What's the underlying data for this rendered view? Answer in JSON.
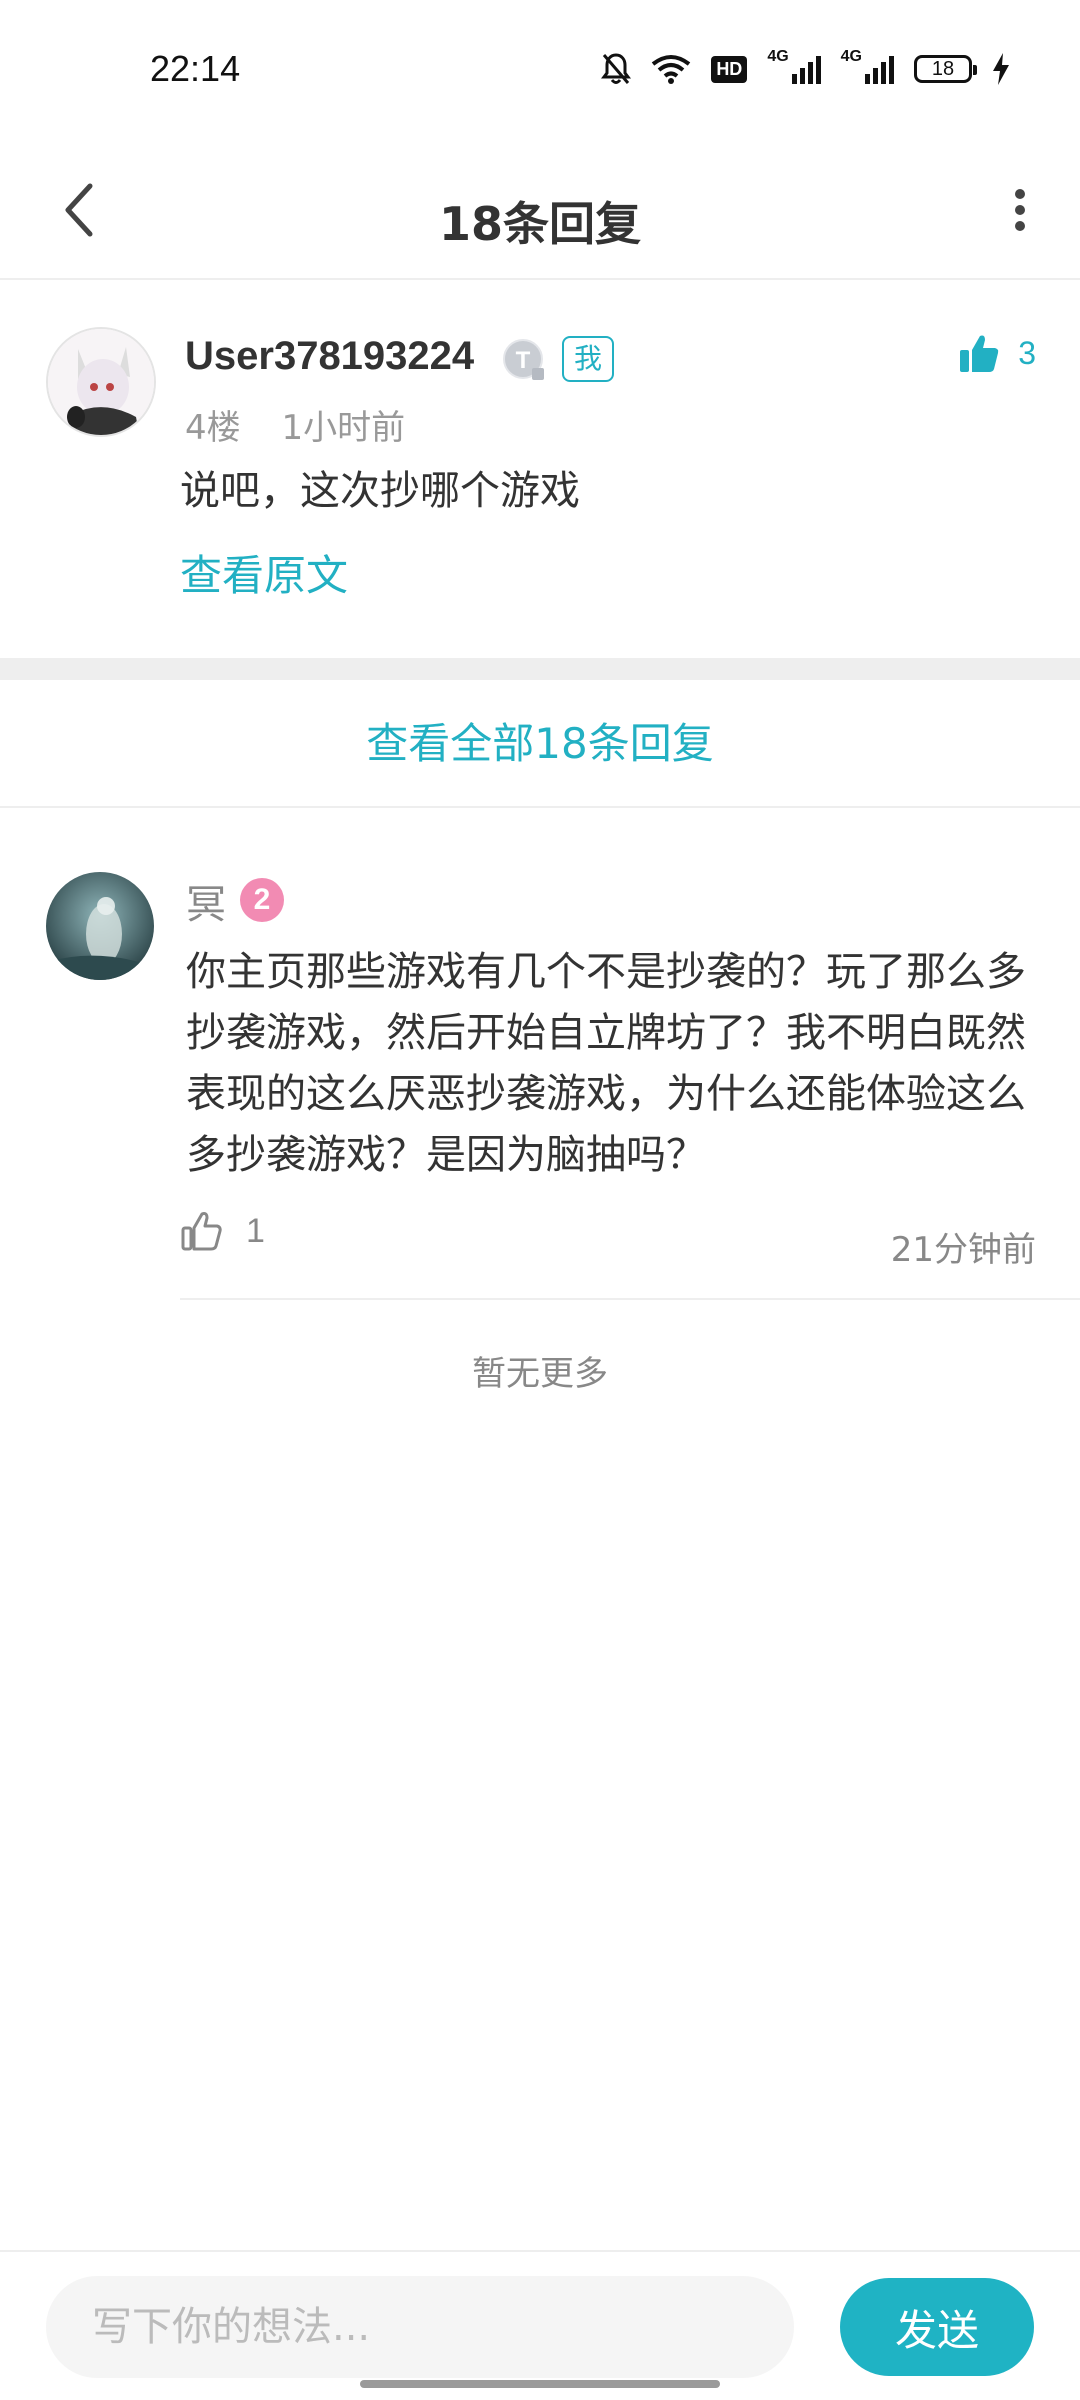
{
  "status": {
    "time": "22:14",
    "hd": "HD",
    "net1": "4G",
    "net2": "4G",
    "battery": "18"
  },
  "nav": {
    "title": "18条回复"
  },
  "main_comment": {
    "username": "User378193224",
    "level_badge": "T",
    "me_tag": "我",
    "floor": "4楼",
    "time": "1小时前",
    "text": "说吧，这次抄哪个游戏",
    "view_original": "查看原文",
    "likes": "3"
  },
  "view_all": "查看全部18条回复",
  "reply": {
    "name": "冥",
    "level": "2",
    "text": "你主页那些游戏有几个不是抄袭的？玩了那么多抄袭游戏，然后开始自立牌坊了？我不明白既然表现的这么厌恶抄袭游戏，为什么还能体验这么多抄袭游戏？是因为脑抽吗？",
    "likes": "1",
    "time": "21分钟前"
  },
  "no_more": "暂无更多",
  "bottom": {
    "placeholder": "写下你的想法...",
    "send": "发送"
  },
  "colors": {
    "accent": "#22b0c3",
    "level_pink": "#f28bb3"
  }
}
